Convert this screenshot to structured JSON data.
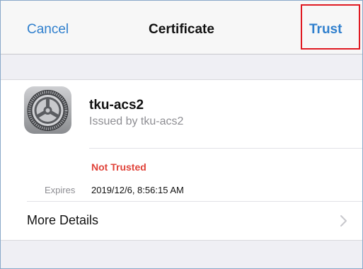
{
  "nav": {
    "cancel_label": "Cancel",
    "title": "Certificate",
    "trust_label": "Trust"
  },
  "certificate": {
    "icon": "gear-icon",
    "name": "tku-acs2",
    "issuer": "Issued by tku-acs2",
    "status": "Not Trusted",
    "expires_label": "Expires",
    "expires_value": "2019/12/6, 8:56:15 AM"
  },
  "details": {
    "label": "More Details",
    "icon": "chevron-right-icon"
  },
  "colors": {
    "accent": "#2f7fcd",
    "danger": "#e0433a",
    "highlight_border": "#e01a22"
  }
}
